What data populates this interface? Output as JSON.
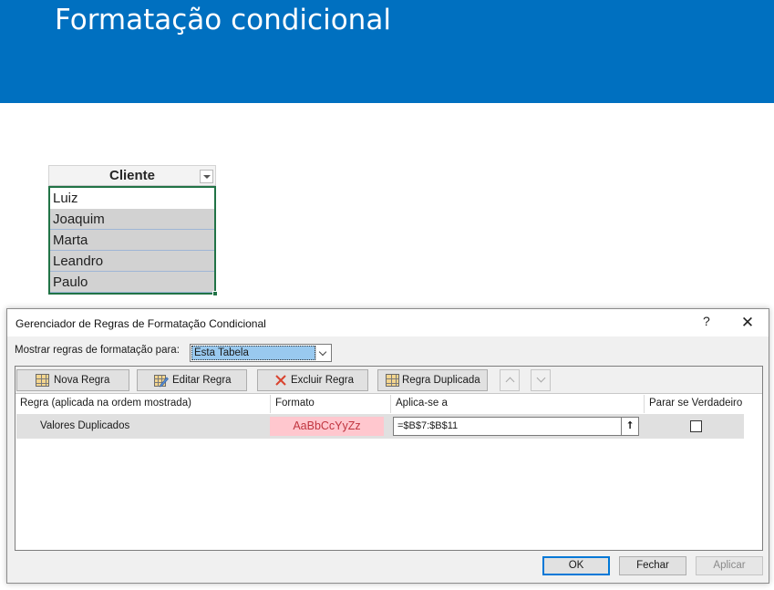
{
  "slide": {
    "title": "Formatação condicional"
  },
  "table": {
    "header": "Cliente",
    "rows": [
      "Luiz",
      "Joaquim",
      "Marta",
      "Leandro",
      "Paulo"
    ]
  },
  "dialog": {
    "title": "Gerenciador de Regras de Formatação Condicional",
    "help": "?",
    "close": "✕",
    "show_rules_label": "Mostrar regras de formatação para:",
    "show_rules_value": "Esta Tabela",
    "toolbar": {
      "new_rule": "Nova Regra",
      "edit_rule": "Editar Regra",
      "delete_rule": "Excluir Regra",
      "duplicate_rule": "Regra Duplicada"
    },
    "columns": {
      "rule": "Regra (aplicada na ordem mostrada)",
      "format": "Formato",
      "applies_to": "Aplica-se a",
      "stop_if_true": "Parar se Verdadeiro"
    },
    "rules": [
      {
        "name": "Valores Duplicados",
        "format_preview": "AaBbCcYyZz",
        "applies_to": "=$B$7:$B$11",
        "stop_if_true": false
      }
    ],
    "buttons": {
      "ok": "OK",
      "close": "Fechar",
      "apply": "Aplicar"
    }
  },
  "colors": {
    "banner": "#0070c0",
    "format_fill": "#ffc7ce",
    "format_text": "#c0353f",
    "selection": "#99c9ef"
  }
}
